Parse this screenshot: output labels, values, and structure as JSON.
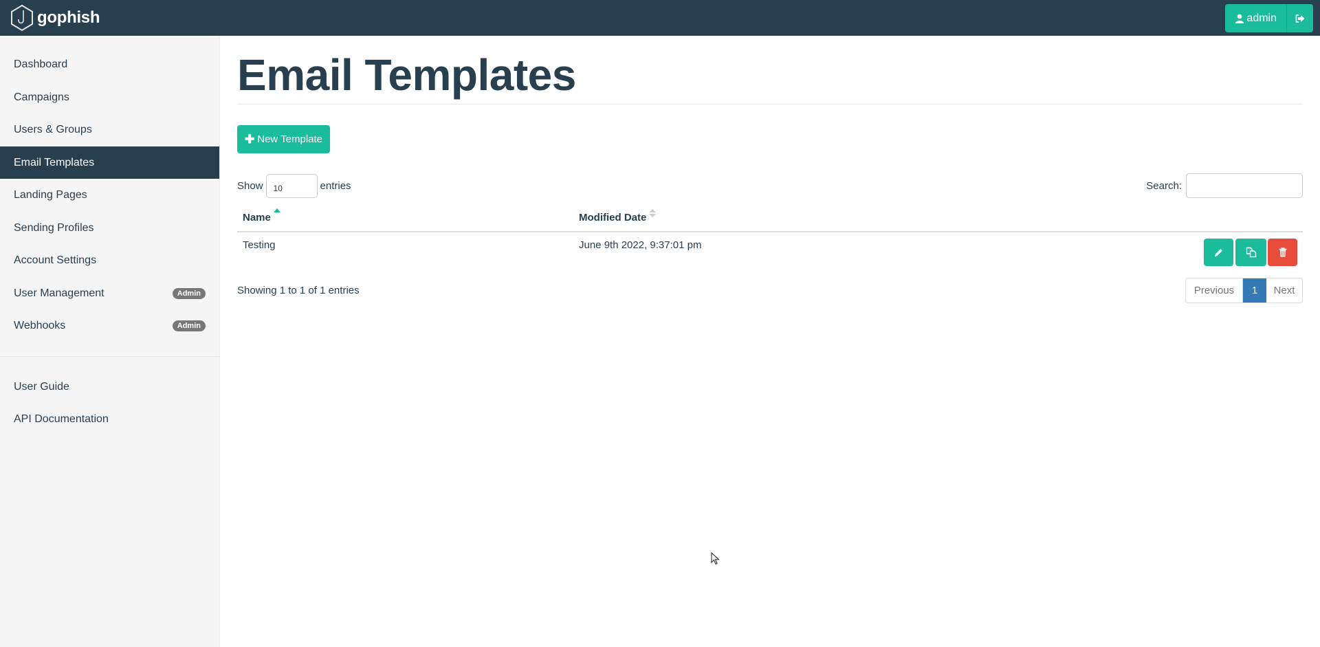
{
  "navbar": {
    "brand": "gophish",
    "user_label": "admin",
    "icons": {
      "brand": "hook-hexagon-logo-icon",
      "user": "user-icon",
      "logout": "sign-out-icon"
    }
  },
  "sidebar": {
    "items": [
      {
        "label": "Dashboard",
        "active": false
      },
      {
        "label": "Campaigns",
        "active": false
      },
      {
        "label": "Users & Groups",
        "active": false
      },
      {
        "label": "Email Templates",
        "active": true
      },
      {
        "label": "Landing Pages",
        "active": false
      },
      {
        "label": "Sending Profiles",
        "active": false
      },
      {
        "label": "Account Settings",
        "active": false
      },
      {
        "label": "User Management",
        "active": false,
        "badge": "Admin"
      },
      {
        "label": "Webhooks",
        "active": false,
        "badge": "Admin"
      }
    ],
    "secondary": [
      {
        "label": "User Guide"
      },
      {
        "label": "API Documentation"
      }
    ]
  },
  "main": {
    "title": "Email Templates",
    "new_button": "New Template",
    "new_button_icon": "plus-icon",
    "length": {
      "prefix": "Show",
      "value": "10",
      "suffix": "entries"
    },
    "search": {
      "label": "Search:",
      "value": ""
    },
    "table": {
      "columns": [
        {
          "label": "Name",
          "sort": "ascending"
        },
        {
          "label": "Modified Date",
          "sort": "none"
        }
      ],
      "rows": [
        {
          "name": "Testing",
          "modified": "June 9th 2022, 9:37:01 pm",
          "actions": [
            "edit",
            "copy",
            "delete"
          ]
        }
      ]
    },
    "info": "Showing 1 to 1 of 1 entries",
    "pagination": {
      "previous": "Previous",
      "pages": [
        "1"
      ],
      "current": "1",
      "next": "Next"
    }
  },
  "colors": {
    "navbar": "#283f50",
    "accent": "#1abc9c",
    "danger": "#e74c3c",
    "page_active": "#337ab7",
    "badge": "#777777",
    "sidebar_bg": "#f5f5f5"
  }
}
